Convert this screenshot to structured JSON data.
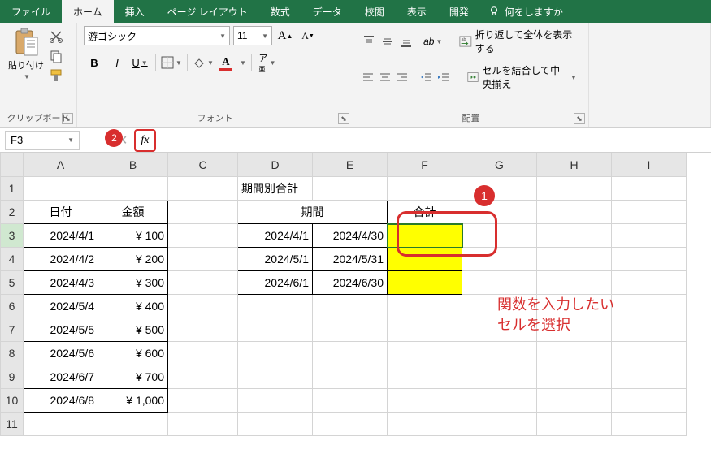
{
  "tabs": {
    "file": "ファイル",
    "home": "ホーム",
    "insert": "挿入",
    "page_layout": "ページ レイアウト",
    "formulas": "数式",
    "data": "データ",
    "review": "校閲",
    "view": "表示",
    "developer": "開発",
    "tell_me": "何をしますか"
  },
  "ribbon": {
    "clipboard": {
      "paste": "貼り付け",
      "label": "クリップボード"
    },
    "font": {
      "name": "游ゴシック",
      "size": "11",
      "label": "フォント",
      "bold": "B",
      "italic": "I",
      "underline": "U"
    },
    "alignment": {
      "wrap": "折り返して全体を表示する",
      "merge": "セルを結合して中央揃え",
      "label": "配置"
    }
  },
  "formula_bar": {
    "cell_ref": "F3",
    "fx": "fx",
    "value": ""
  },
  "annotations": {
    "badge1": "1",
    "badge2": "2",
    "text": "関数を入力したい\nセルを選択"
  },
  "sheet": {
    "cols": [
      "A",
      "B",
      "C",
      "D",
      "E",
      "F",
      "G",
      "H",
      "I"
    ],
    "rows": [
      "1",
      "2",
      "3",
      "4",
      "5",
      "6",
      "7",
      "8",
      "9",
      "10",
      "11"
    ],
    "headers": {
      "date": "日付",
      "amount": "金額",
      "period_total": "期間別合計",
      "period": "期間",
      "total": "合計"
    },
    "data_left": [
      {
        "date": "2024/4/1",
        "amt": "¥    100"
      },
      {
        "date": "2024/4/2",
        "amt": "¥    200"
      },
      {
        "date": "2024/4/3",
        "amt": "¥    300"
      },
      {
        "date": "2024/5/4",
        "amt": "¥    400"
      },
      {
        "date": "2024/5/5",
        "amt": "¥    500"
      },
      {
        "date": "2024/5/6",
        "amt": "¥    600"
      },
      {
        "date": "2024/6/7",
        "amt": "¥    700"
      },
      {
        "date": "2024/6/8",
        "amt": "¥  1,000"
      }
    ],
    "data_right": [
      {
        "start": "2024/4/1",
        "end": "2024/4/30"
      },
      {
        "start": "2024/5/1",
        "end": "2024/5/31"
      },
      {
        "start": "2024/6/1",
        "end": "2024/6/30"
      }
    ]
  }
}
